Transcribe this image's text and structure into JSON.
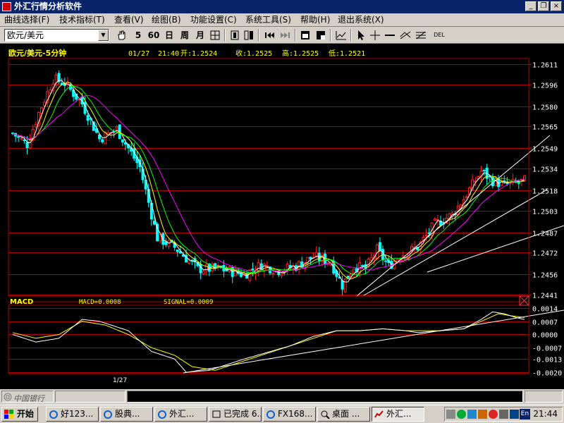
{
  "window": {
    "title": "外汇行情分析软件"
  },
  "menu": [
    {
      "label": "曲线选择(F)"
    },
    {
      "label": "技术指标(T)"
    },
    {
      "label": "查看(V)"
    },
    {
      "label": "绘图(B)"
    },
    {
      "label": "功能设置(C)"
    },
    {
      "label": "系统工具(S)"
    },
    {
      "label": "帮助(H)"
    },
    {
      "label": "退出系统(X)"
    }
  ],
  "toolbar": {
    "symbol": "欧元/美元",
    "period_5": "5",
    "period_60": "60",
    "period_day": "日",
    "period_week": "周",
    "period_month": "月",
    "del_label": "DEL"
  },
  "chart_data": [
    {
      "type": "candlestick",
      "title": "欧元/美元-5分钟",
      "header": {
        "date": "01/27",
        "time": "21:40",
        "open": "开:1.2524",
        "high": "高:1.2525",
        "low": "低:1.2521",
        "close": "收:1.2525"
      },
      "y_ticks": [
        "1.2611",
        "1.2596",
        "1.2580",
        "1.2565",
        "1.2549",
        "1.2534",
        "1.2518",
        "1.2503",
        "1.2487",
        "1.2472",
        "1.2456",
        "1.2441"
      ],
      "ylim": [
        1.2441,
        1.2611
      ],
      "colors": {
        "up": "#ff2020",
        "down": "#00ffff",
        "ma_fast": "#ffffff",
        "ma_mid": "#ffff00",
        "ma_slow": "#00ff00",
        "ma_long": "#ff00ff",
        "grid": "#b00000"
      },
      "close_path": [
        [
          0,
          1.256
        ],
        [
          5,
          1.2552
        ],
        [
          9,
          1.2575
        ],
        [
          14,
          1.26
        ],
        [
          18,
          1.2597
        ],
        [
          24,
          1.2582
        ],
        [
          30,
          1.2556
        ],
        [
          36,
          1.2563
        ],
        [
          44,
          1.2535
        ],
        [
          50,
          1.2483
        ],
        [
          56,
          1.2476
        ],
        [
          64,
          1.246
        ],
        [
          72,
          1.246
        ],
        [
          80,
          1.2456
        ],
        [
          86,
          1.2463
        ],
        [
          92,
          1.2459
        ],
        [
          98,
          1.2462
        ],
        [
          104,
          1.2469
        ],
        [
          110,
          1.2465
        ],
        [
          114,
          1.2448
        ],
        [
          118,
          1.2462
        ],
        [
          122,
          1.246
        ],
        [
          126,
          1.2474
        ],
        [
          130,
          1.2462
        ],
        [
          134,
          1.247
        ],
        [
          140,
          1.2476
        ],
        [
          146,
          1.2493
        ],
        [
          152,
          1.25
        ],
        [
          156,
          1.2512
        ],
        [
          162,
          1.2532
        ],
        [
          166,
          1.2525
        ],
        [
          170,
          1.2522
        ],
        [
          174,
          1.2523
        ],
        [
          177,
          1.2525
        ]
      ]
    },
    {
      "type": "line",
      "title": "MACD",
      "labels": {
        "macd": "MACD=0.0008",
        "signal": "SIGNAL=0.0009"
      },
      "y_ticks": [
        "0.0014",
        "0.0007",
        "0.0000",
        "-0.0007",
        "-0.0013",
        "-0.0020"
      ],
      "ylim": [
        -0.002,
        0.0014
      ],
      "x_label": "1/27",
      "colors": {
        "macd": "#ffffff",
        "signal": "#ffff00",
        "grid": "#b00000"
      },
      "macd_path": [
        [
          0,
          0.0
        ],
        [
          8,
          -0.0004
        ],
        [
          16,
          -0.0002
        ],
        [
          24,
          0.0008
        ],
        [
          30,
          0.0007
        ],
        [
          40,
          0.0002
        ],
        [
          48,
          -0.0009
        ],
        [
          56,
          -0.0013
        ],
        [
          60,
          -0.002
        ],
        [
          68,
          -0.0019
        ],
        [
          80,
          -0.0013
        ],
        [
          96,
          -0.0006
        ],
        [
          104,
          -0.0001
        ],
        [
          112,
          0.0002
        ],
        [
          120,
          0.0002
        ],
        [
          128,
          0.0003
        ],
        [
          136,
          0.0002
        ],
        [
          140,
          0.0001
        ],
        [
          148,
          0.0002
        ],
        [
          156,
          0.0003
        ],
        [
          162,
          0.0008
        ],
        [
          166,
          0.0012
        ],
        [
          170,
          0.0011
        ],
        [
          174,
          0.0009
        ],
        [
          177,
          0.0008
        ]
      ],
      "signal_path": [
        [
          0,
          0.0001
        ],
        [
          8,
          -0.0002
        ],
        [
          16,
          0.0
        ],
        [
          24,
          0.0007
        ],
        [
          32,
          0.0005
        ],
        [
          40,
          0.0
        ],
        [
          48,
          -0.0007
        ],
        [
          56,
          -0.0011
        ],
        [
          62,
          -0.0017
        ],
        [
          70,
          -0.0019
        ],
        [
          80,
          -0.0014
        ],
        [
          96,
          -0.0006
        ],
        [
          104,
          -0.0002
        ],
        [
          112,
          0.0002
        ],
        [
          120,
          0.0002
        ],
        [
          128,
          0.0003
        ],
        [
          136,
          0.0002
        ],
        [
          140,
          0.0002
        ],
        [
          148,
          0.0002
        ],
        [
          156,
          0.0003
        ],
        [
          162,
          0.0007
        ],
        [
          168,
          0.0011
        ],
        [
          172,
          0.001
        ],
        [
          177,
          0.0009
        ]
      ]
    }
  ],
  "status": {
    "logo": "中国银行"
  },
  "taskbar": {
    "start": "开始",
    "tasks": [
      {
        "label": "好123..."
      },
      {
        "label": "股典..."
      },
      {
        "label": "外汇..."
      },
      {
        "label": "已完成 6..."
      },
      {
        "label": "FX168..."
      },
      {
        "label": "桌面 ..."
      },
      {
        "label": "外汇..."
      }
    ],
    "tray_lang": "En",
    "clock": "21:44"
  }
}
